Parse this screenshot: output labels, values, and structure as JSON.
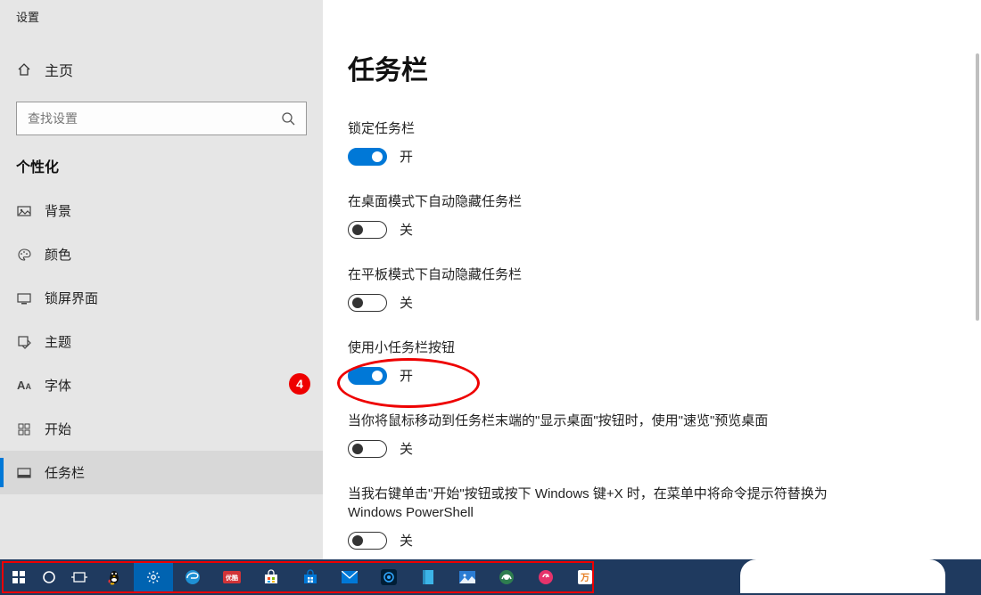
{
  "window": {
    "title": "设置"
  },
  "sidebar": {
    "home": "主页",
    "search_placeholder": "查找设置",
    "section": "个性化",
    "items": [
      {
        "icon": "image",
        "label": "背景"
      },
      {
        "icon": "palette",
        "label": "颜色"
      },
      {
        "icon": "lockscreen",
        "label": "锁屏界面"
      },
      {
        "icon": "theme",
        "label": "主题"
      },
      {
        "icon": "font",
        "label": "字体"
      },
      {
        "icon": "start",
        "label": "开始"
      },
      {
        "icon": "taskbar",
        "label": "任务栏"
      }
    ]
  },
  "main": {
    "heading": "任务栏",
    "settings": [
      {
        "label": "锁定任务栏",
        "on": true,
        "state": "开"
      },
      {
        "label": "在桌面模式下自动隐藏任务栏",
        "on": false,
        "state": "关"
      },
      {
        "label": "在平板模式下自动隐藏任务栏",
        "on": false,
        "state": "关"
      },
      {
        "label": "使用小任务栏按钮",
        "on": true,
        "state": "开"
      },
      {
        "label": "当你将鼠标移动到任务栏末端的\"显示桌面\"按钮时，使用\"速览\"预览桌面",
        "on": false,
        "state": "关"
      },
      {
        "label": "当我右键单击\"开始\"按钮或按下 Windows 键+X 时，在菜单中将命令提示符替换为 Windows PowerShell",
        "on": false,
        "state": "关"
      }
    ]
  },
  "annotation": {
    "number": "4"
  },
  "taskbar_icons": [
    "start",
    "cortana",
    "taskview",
    "qq",
    "settings",
    "edge",
    "video",
    "store-alt",
    "store",
    "mail",
    "photoshop",
    "book",
    "photos",
    "360",
    "music",
    "app"
  ]
}
